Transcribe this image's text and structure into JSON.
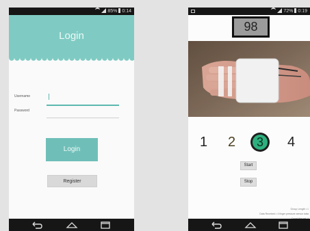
{
  "login_screen": {
    "status_time": "0:14",
    "status_percent": "85%",
    "title": "Login",
    "username_label": "Username",
    "password_label": "Password",
    "login_button": "Login",
    "register_button": "Register"
  },
  "monitor_screen": {
    "status_time": "0:19",
    "status_percent": "72%",
    "counter_value": "98",
    "numbers": [
      "1",
      "2",
      "3",
      "4"
    ],
    "active_number": "3",
    "start_button": "Start",
    "stop_button": "Stop",
    "footer_lines": [
      "Group Length • 1",
      "Data Received • 4 finger pressure sensor data",
      "Count this set: 4"
    ]
  },
  "colors": {
    "header_teal": "#7fcbc3",
    "button_teal": "#6fbfb8",
    "active_green": "#2eb07e"
  }
}
